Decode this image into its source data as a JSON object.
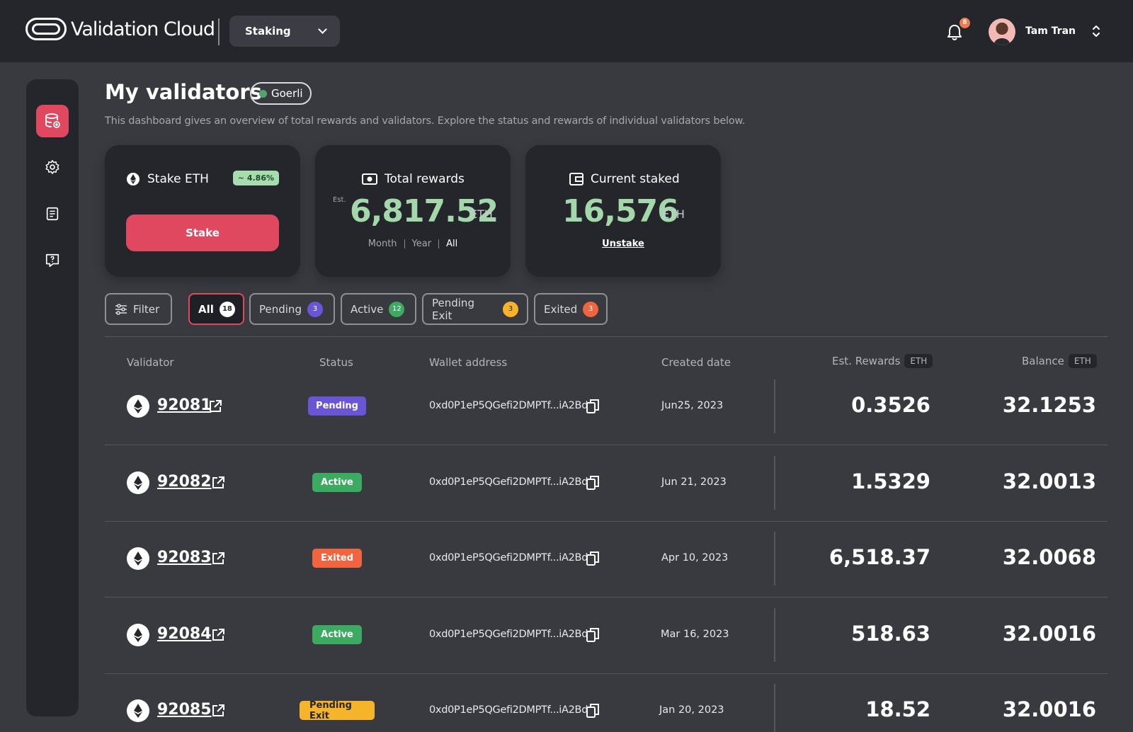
{
  "brand": {
    "name": "Validation Cloud"
  },
  "header": {
    "product": "Staking",
    "notifications": "8",
    "user_name": "Tam Tran"
  },
  "page": {
    "title": "My validators",
    "network": "Goerli",
    "subtitle": "This dashboard gives an overview of total rewards and validators. Explore the status and rewards of individual validators below."
  },
  "cards": {
    "stake": {
      "title": "Stake ETH",
      "apr": "~ 4.86%",
      "button": "Stake"
    },
    "rewards": {
      "title": "Total rewards",
      "est": "Est.",
      "value": "6,817.52",
      "unit": "ETH",
      "periods": [
        "Month",
        "Year",
        "All"
      ],
      "selected_period": "All"
    },
    "staked": {
      "title": "Current staked",
      "value": "16,576",
      "unit": "ETH",
      "link": "Unstake"
    }
  },
  "filters": {
    "filter_label": "Filter",
    "tabs": [
      {
        "label": "All",
        "count": "18"
      },
      {
        "label": "Pending",
        "count": "3"
      },
      {
        "label": "Active",
        "count": "12"
      },
      {
        "label": "Pending Exit",
        "count": "3"
      },
      {
        "label": "Exited",
        "count": "3"
      }
    ]
  },
  "table": {
    "columns": [
      "Validator",
      "Status",
      "Wallet address",
      "Created date",
      "Est. Rewards",
      "Balance"
    ],
    "unit_tag": "ETH",
    "rows": [
      {
        "id": "92081",
        "status": "Pending",
        "wallet": "0xd0P1eP5QGefi2DMPTf...iA2Bd",
        "date": "Jun25, 2023",
        "rewards": "0.3526",
        "balance": "32.1253"
      },
      {
        "id": "92082",
        "status": "Active",
        "wallet": "0xd0P1eP5QGefi2DMPTf...iA2Bd",
        "date": "Jun 21, 2023",
        "rewards": "1.5329",
        "balance": "32.0013"
      },
      {
        "id": "92083",
        "status": "Exited",
        "wallet": "0xd0P1eP5QGefi2DMPTf...iA2Bd",
        "date": "Apr 10, 2023",
        "rewards": "6,518.37",
        "balance": "32.0068"
      },
      {
        "id": "92084",
        "status": "Active",
        "wallet": "0xd0P1eP5QGefi2DMPTf...iA2Bd",
        "date": "Mar 16, 2023",
        "rewards": "518.63",
        "balance": "32.0016"
      },
      {
        "id": "92085",
        "status": "Pending Exit",
        "wallet": "0xd0P1eP5QGefi2DMPTf...iA2Bd",
        "date": "Jan 20, 2023",
        "rewards": "18.52",
        "balance": "32.0016"
      }
    ]
  },
  "colors": {
    "accent": "#e0485f",
    "pending": "#6a55d6",
    "active": "#3daa62",
    "exited": "#f0643f",
    "pending_exit": "#f5b42a",
    "value_green": "#a3d9aa"
  },
  "icons": {
    "sidebar": [
      "database-icon",
      "gear-icon",
      "document-icon",
      "help-chat-icon"
    ]
  }
}
